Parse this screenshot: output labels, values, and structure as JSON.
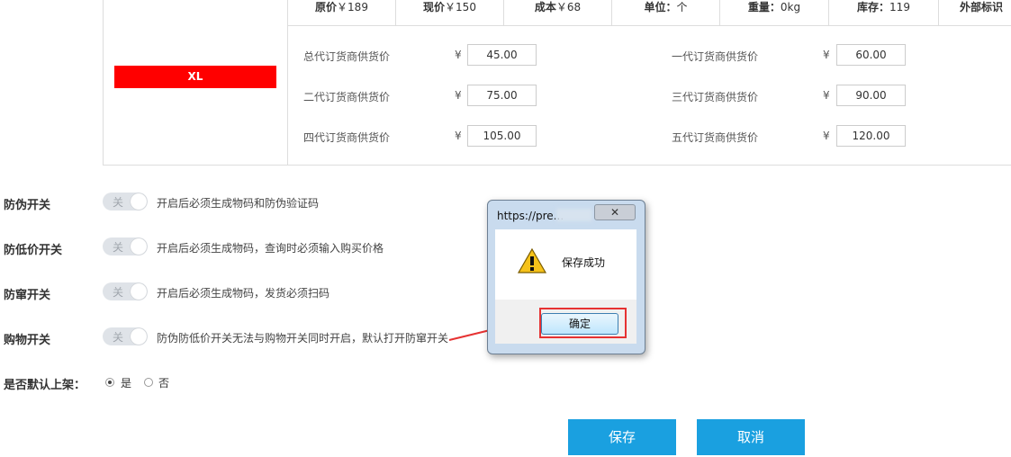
{
  "sku": {
    "size_label": "XL"
  },
  "header": [
    {
      "label": "原价",
      "value": "￥189"
    },
    {
      "label": "现价",
      "value": "￥150"
    },
    {
      "label": "成本",
      "value": "￥68"
    },
    {
      "label": "单位：",
      "value": "个"
    },
    {
      "label": "重量：",
      "value": "0kg"
    },
    {
      "label": "库存：",
      "value": "119"
    },
    {
      "label": "外部标识",
      "value": ""
    }
  ],
  "prices": [
    {
      "label": "总代订货商供货价",
      "currency": "¥",
      "value": "45.00"
    },
    {
      "label": "一代订货商供货价",
      "currency": "¥",
      "value": "60.00"
    },
    {
      "label": "二代订货商供货价",
      "currency": "¥",
      "value": "75.00"
    },
    {
      "label": "三代订货商供货价",
      "currency": "¥",
      "value": "90.00"
    },
    {
      "label": "四代订货商供货价",
      "currency": "¥",
      "value": "105.00"
    },
    {
      "label": "五代订货商供货价",
      "currency": "¥",
      "value": "120.00"
    }
  ],
  "switches": [
    {
      "label": "防伪开关",
      "state": "关",
      "desc": "开启后必须生成物码和防伪验证码"
    },
    {
      "label": "防低价开关",
      "state": "关",
      "desc": "开启后必须生成物码，查询时必须输入购买价格"
    },
    {
      "label": "防窜开关",
      "state": "关",
      "desc": "开启后必须生成物码，发货必须扫码"
    },
    {
      "label": "购物开关",
      "state": "关",
      "desc": "防伪防低价开关无法与购物开关同时开启，默认打开防窜开关"
    }
  ],
  "shelf": {
    "label": "是否默认上架：",
    "options": [
      {
        "label": "是",
        "selected": true
      },
      {
        "label": "否",
        "selected": false
      }
    ]
  },
  "actions": {
    "save": "保存",
    "cancel": "取消"
  },
  "dialog": {
    "title": "https://pre...",
    "close": "✕",
    "message": "保存成功",
    "ok": "确定"
  },
  "colors": {
    "sku_tag": "#ff0000",
    "primary_button": "#1aa0e0",
    "highlight": "#e63232",
    "arrow": "#e63232"
  }
}
